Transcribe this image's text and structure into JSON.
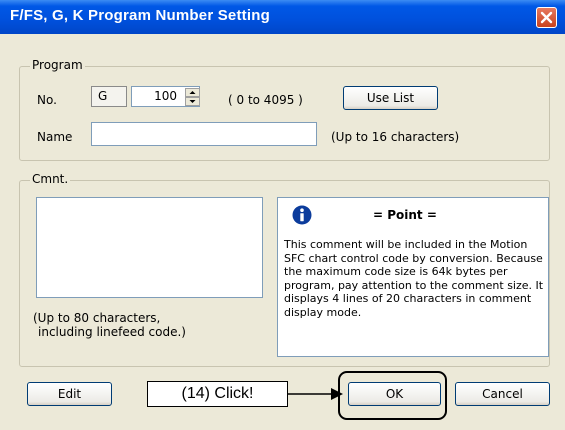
{
  "window": {
    "title": "F/FS, G, K Program Number Setting"
  },
  "program_group": {
    "legend": "Program",
    "no_label": "No.",
    "type_value": "G",
    "number_value": "100",
    "range_hint": "( 0 to 4095 )",
    "use_list_button": "Use List",
    "name_label": "Name",
    "name_value": "",
    "name_hint": "(Up to 16 characters)"
  },
  "comment_group": {
    "legend": "Cmnt.",
    "comment_value": "",
    "limit_hint_line1": "(Up to 80 characters,",
    "limit_hint_line2": "including linefeed code.)"
  },
  "point": {
    "heading": "= Point =",
    "body": "This comment will be included in the Motion SFC chart control code by conversion. Because the maximum code size is 64k bytes per program, pay attention to the comment size. It displays 4 lines of 20 characters in comment display mode."
  },
  "buttons": {
    "edit": "Edit",
    "ok": "OK",
    "cancel": "Cancel"
  },
  "annotation": {
    "text": "(14) Click!"
  },
  "icons": [
    "close-icon",
    "info-icon",
    "spin-up-icon",
    "spin-down-icon",
    "arrow-right-icon"
  ],
  "colors": {
    "titlebar": "#0054e3",
    "dialog_bg": "#ece9d8",
    "close": "#d7552a",
    "info_icon": "#0c3c9c"
  }
}
